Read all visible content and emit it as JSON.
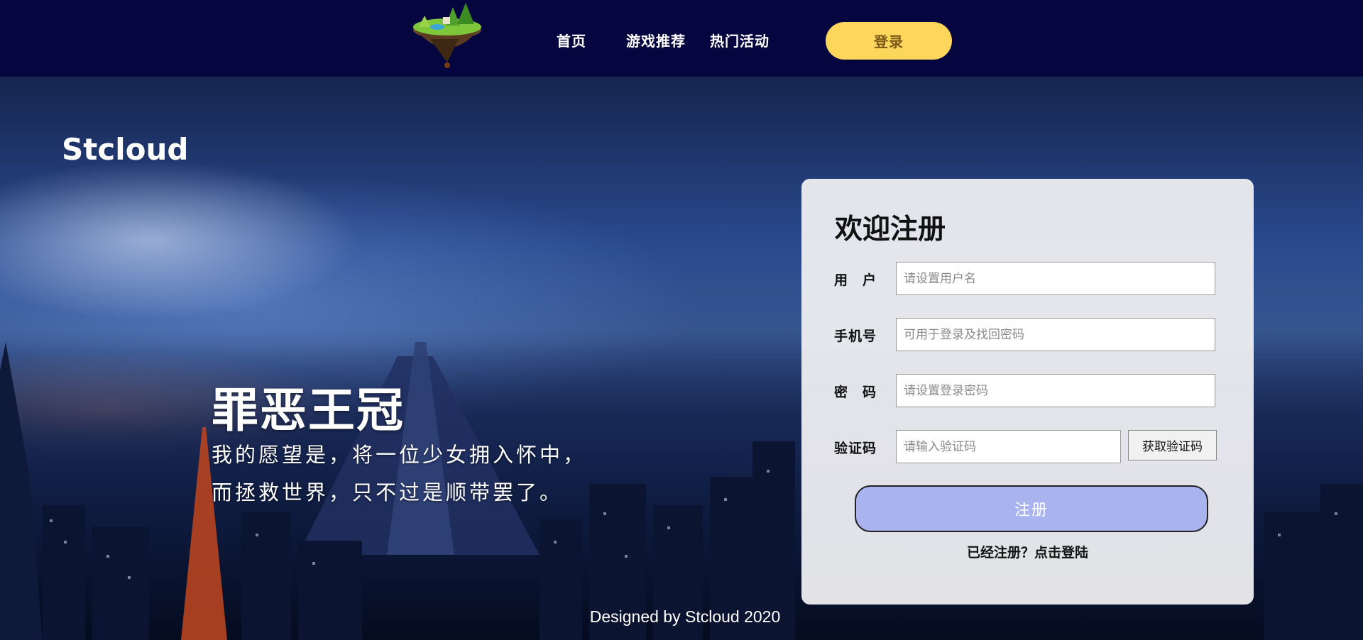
{
  "nav": {
    "logo_icon": "floating-island-logo",
    "items": [
      "首页",
      "游戏推荐",
      "热门活动"
    ],
    "login_label": "登录"
  },
  "hero": {
    "brand": "Stcloud",
    "game_title": "罪恶王冠",
    "quote_lines": [
      "我的愿望是，将一位少女拥入怀中，",
      "而拯救世界，只不过是顺带罢了。"
    ]
  },
  "register": {
    "title": "欢迎注册",
    "fields": [
      {
        "label": "用　户",
        "placeholder": "请设置用户名",
        "value": ""
      },
      {
        "label": "手机号",
        "placeholder": "可用于登录及找回密码",
        "value": ""
      },
      {
        "label": "密　码",
        "placeholder": "请设置登录密码",
        "value": ""
      },
      {
        "label": "验证码",
        "placeholder": "请输入验证码",
        "value": ""
      }
    ],
    "get_code_label": "获取验证码",
    "submit_label": "注册",
    "signin_link": "已经注册？点击登陆"
  },
  "footer": {
    "text": "Designed by Stcloud 2020"
  },
  "colors": {
    "nav_bg": "#05053f",
    "login_button": "#fdd65c",
    "submit_button": "#a9b4ef",
    "panel_bg": "#eeeef1"
  }
}
